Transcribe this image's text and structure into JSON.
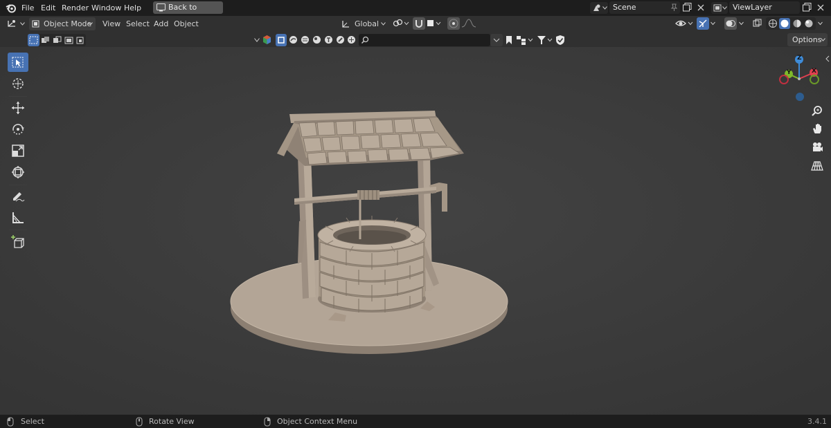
{
  "topbar": {
    "menus": [
      "File",
      "Edit",
      "Render",
      "Window",
      "Help"
    ],
    "back_button": "Back to Previous",
    "scene_name": "Scene",
    "view_layer_name": "ViewLayer"
  },
  "header": {
    "mode": "Object Mode",
    "menus": [
      "View",
      "Select",
      "Add",
      "Object"
    ],
    "orientation": "Global",
    "options_label": "Options"
  },
  "search": {
    "placeholder": ""
  },
  "tools": [
    {
      "name": "select-box-icon",
      "active": true
    },
    {
      "name": "cursor-icon",
      "active": false
    },
    {
      "name": "move-icon",
      "active": false
    },
    {
      "name": "rotate-icon",
      "active": false
    },
    {
      "name": "scale-icon",
      "active": false
    },
    {
      "name": "transform-icon",
      "active": false
    },
    {
      "name": "annotate-icon",
      "active": false
    },
    {
      "name": "measure-icon",
      "active": false
    },
    {
      "name": "add-cube-icon",
      "active": false
    }
  ],
  "gizmo": {
    "x": "X",
    "y": "Y",
    "z": "Z"
  },
  "statusbar": {
    "select": "Select",
    "rotate_view": "Rotate View",
    "context_menu": "Object Context Menu",
    "version": "3.4.1"
  },
  "colors": {
    "accent": "#4772b3",
    "x_axis": "#e0404f",
    "y_axis": "#7fb92a",
    "z_axis": "#3e8bd8",
    "model": "#a8998a",
    "viewport_bg": "#3d3d3d"
  }
}
